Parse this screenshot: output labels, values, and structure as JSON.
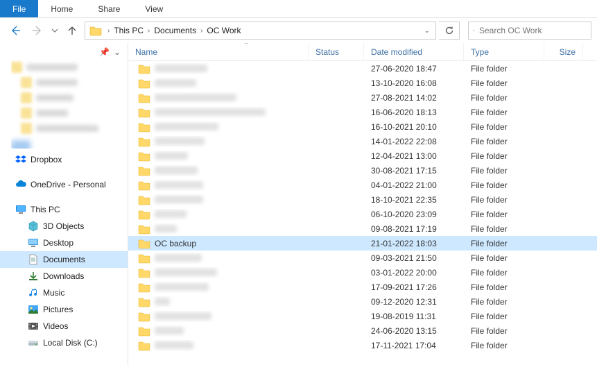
{
  "ribbon": {
    "file": "File",
    "home": "Home",
    "share": "Share",
    "view": "View"
  },
  "breadcrumbs": [
    "This PC",
    "Documents",
    "OC Work"
  ],
  "search": {
    "placeholder": "Search OC Work"
  },
  "sidebar": {
    "cloud": [
      {
        "label": "Dropbox",
        "icon": "dropbox"
      },
      {
        "label": "OneDrive - Personal",
        "icon": "onedrive"
      }
    ],
    "thispc": {
      "label": "This PC"
    },
    "thispc_children": [
      {
        "label": "3D Objects",
        "icon": "3d"
      },
      {
        "label": "Desktop",
        "icon": "desktop"
      },
      {
        "label": "Documents",
        "icon": "documents",
        "selected": true
      },
      {
        "label": "Downloads",
        "icon": "downloads"
      },
      {
        "label": "Music",
        "icon": "music"
      },
      {
        "label": "Pictures",
        "icon": "pictures"
      },
      {
        "label": "Videos",
        "icon": "videos"
      },
      {
        "label": "Local Disk (C:)",
        "icon": "disk"
      }
    ]
  },
  "columns": {
    "name": "Name",
    "status": "Status",
    "date": "Date modified",
    "type": "Type",
    "size": "Size"
  },
  "rows": [
    {
      "name": "",
      "blur_w": 76,
      "date": "27-06-2020 18:47",
      "type": "File folder"
    },
    {
      "name": "",
      "blur_w": 60,
      "date": "13-10-2020 16:08",
      "type": "File folder"
    },
    {
      "name": "",
      "blur_w": 118,
      "date": "27-08-2021 14:02",
      "type": "File folder"
    },
    {
      "name": "",
      "blur_w": 160,
      "date": "16-06-2020 18:13",
      "type": "File folder"
    },
    {
      "name": "",
      "blur_w": 92,
      "date": "16-10-2021 20:10",
      "type": "File folder"
    },
    {
      "name": "",
      "blur_w": 72,
      "date": "14-01-2022 22:08",
      "type": "File folder"
    },
    {
      "name": "",
      "blur_w": 48,
      "date": "12-04-2021 13:00",
      "type": "File folder"
    },
    {
      "name": "",
      "blur_w": 62,
      "date": "30-08-2021 17:15",
      "type": "File folder"
    },
    {
      "name": "",
      "blur_w": 70,
      "date": "04-01-2022 21:00",
      "type": "File folder"
    },
    {
      "name": "",
      "blur_w": 70,
      "date": "18-10-2021 22:35",
      "type": "File folder"
    },
    {
      "name": "",
      "blur_w": 46,
      "date": "06-10-2020 23:09",
      "type": "File folder"
    },
    {
      "name": "",
      "blur_w": 32,
      "date": "09-08-2021 17:19",
      "type": "File folder"
    },
    {
      "name": "OC backup",
      "date": "21-01-2022 18:03",
      "type": "File folder",
      "selected": true
    },
    {
      "name": "",
      "blur_w": 68,
      "date": "09-03-2021 21:50",
      "type": "File folder"
    },
    {
      "name": "",
      "blur_w": 90,
      "date": "03-01-2022 20:00",
      "type": "File folder"
    },
    {
      "name": "",
      "blur_w": 78,
      "date": "17-09-2021 17:26",
      "type": "File folder"
    },
    {
      "name": "",
      "blur_w": 22,
      "date": "09-12-2020 12:31",
      "type": "File folder"
    },
    {
      "name": "",
      "blur_w": 82,
      "date": "19-08-2019 11:31",
      "type": "File folder"
    },
    {
      "name": "",
      "blur_w": 42,
      "date": "24-06-2020 13:15",
      "type": "File folder"
    },
    {
      "name": "",
      "blur_w": 56,
      "date": "17-11-2021 17:04",
      "type": "File folder"
    }
  ]
}
